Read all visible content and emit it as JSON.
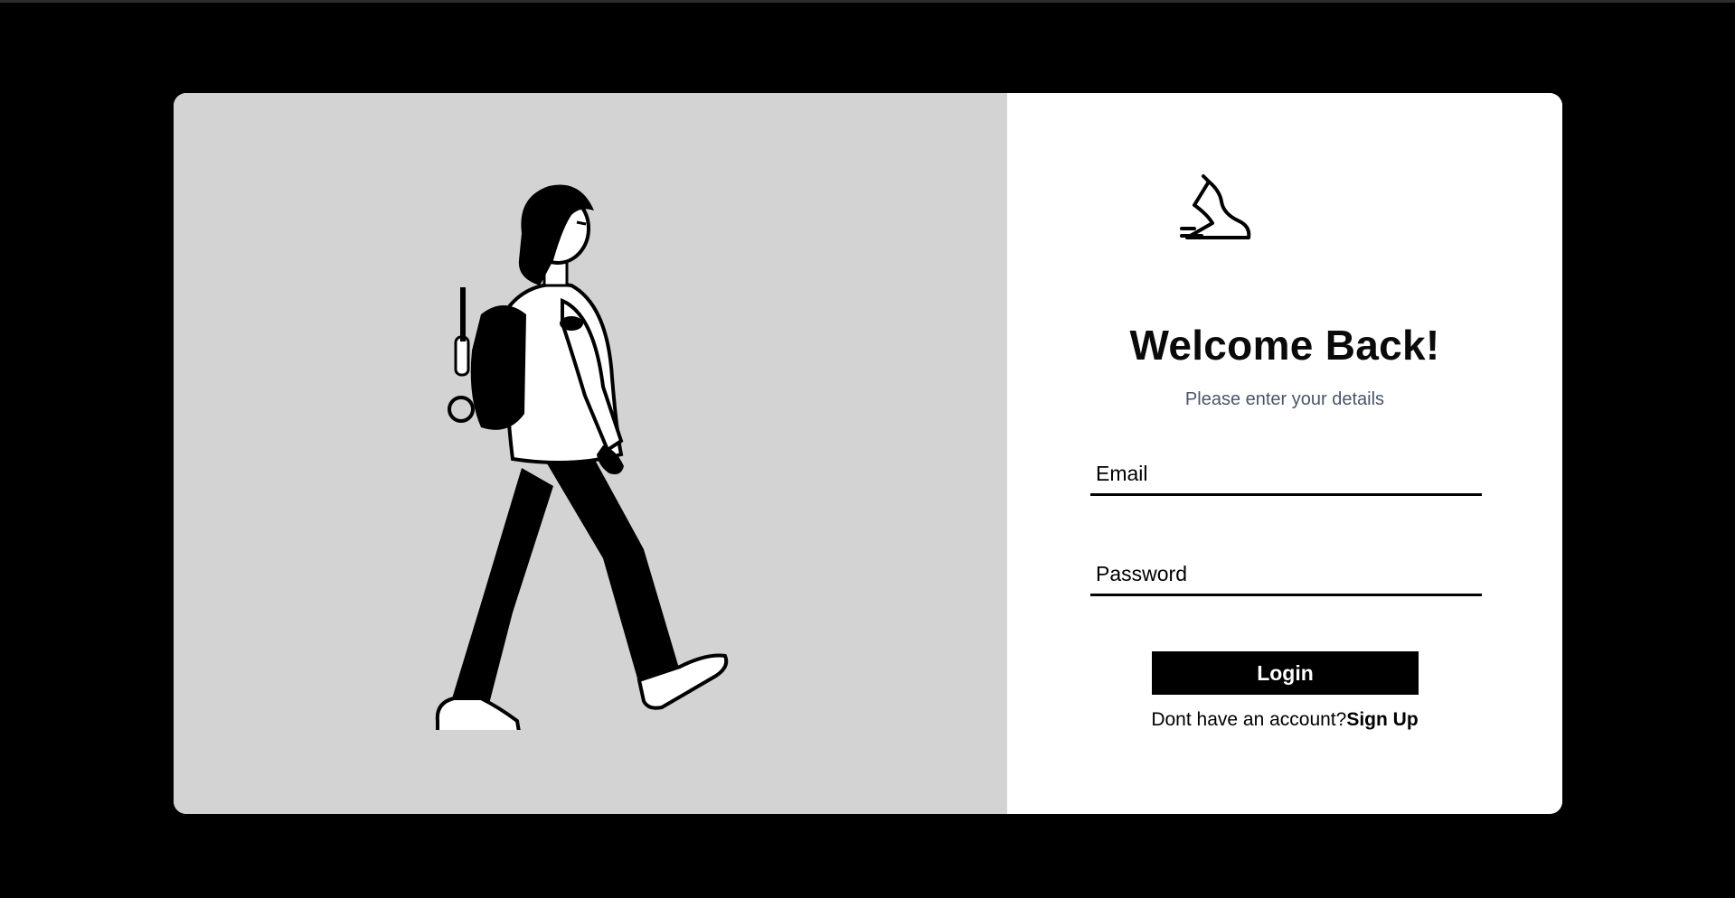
{
  "colors": {
    "page_background": "#000000",
    "illustration_background": "#d3d3d3",
    "form_background": "#ffffff",
    "button_background": "#000000",
    "button_text": "#ffffff",
    "subtitle_text": "#4a5568"
  },
  "illustration": {
    "icon": "walking-girl-illustration"
  },
  "form": {
    "logo_icon": "running-shoe-icon",
    "title": "Welcome Back!",
    "subtitle": "Please enter your details",
    "email": {
      "placeholder": "Email",
      "value": ""
    },
    "password": {
      "placeholder": "Password",
      "value": ""
    },
    "login_label": "Login",
    "signup_prompt": "Dont have an account?",
    "signup_link": "Sign Up"
  }
}
